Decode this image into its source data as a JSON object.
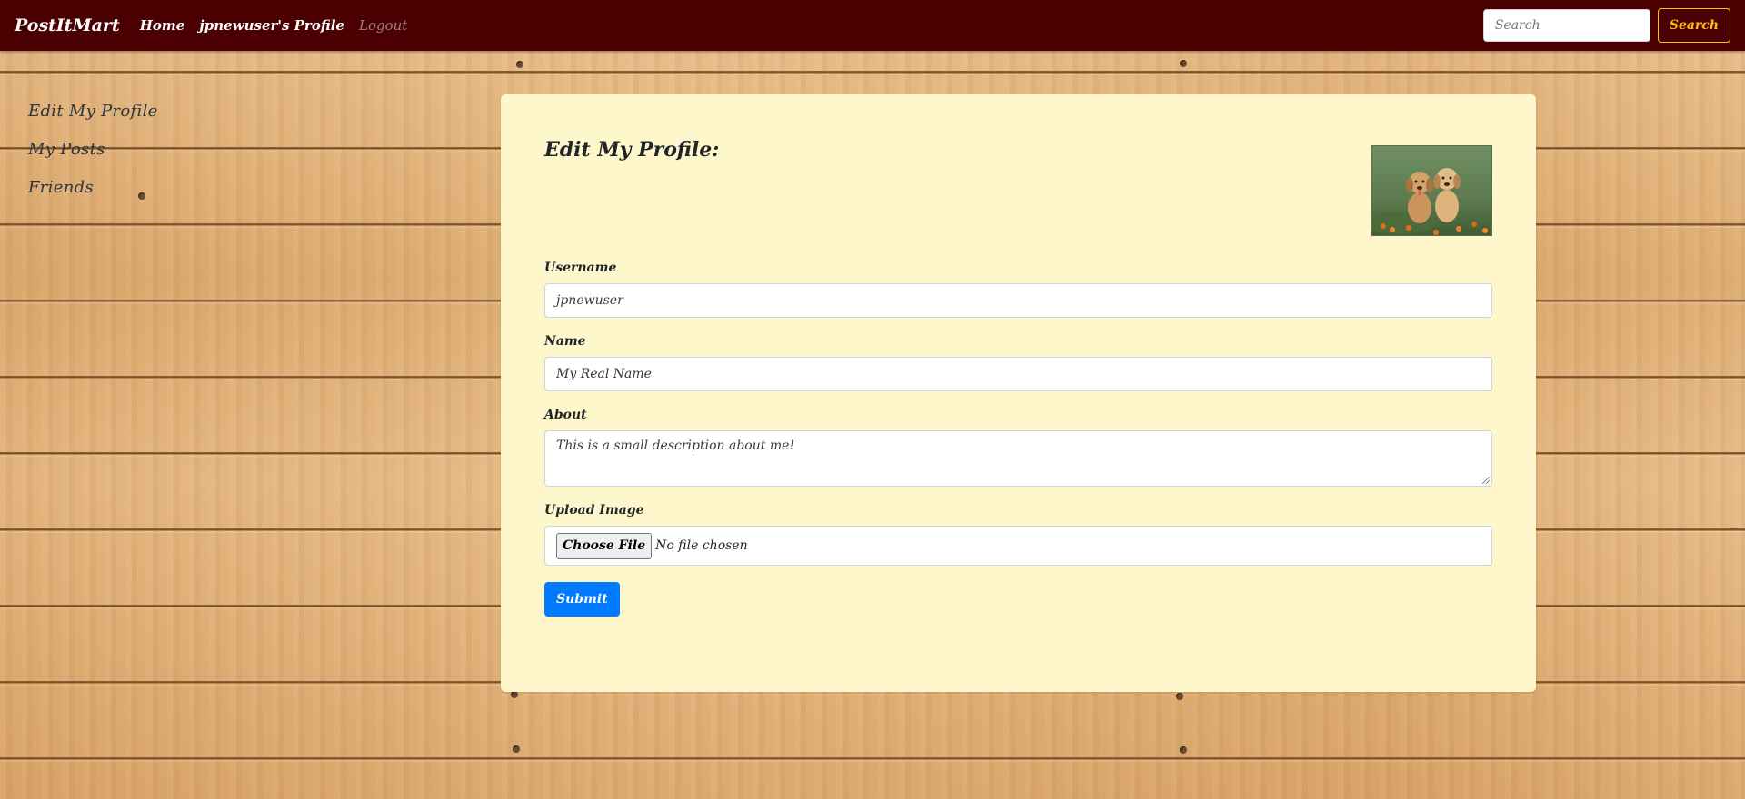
{
  "navbar": {
    "brand": "PostItMart",
    "links": [
      {
        "label": "Home"
      },
      {
        "label": "jpnewuser's Profile"
      },
      {
        "label": "Logout"
      }
    ],
    "search": {
      "placeholder": "Search",
      "button_label": "Search"
    }
  },
  "sidebar": {
    "items": [
      {
        "label": "Edit My Profile"
      },
      {
        "label": "My Posts"
      },
      {
        "label": "Friends"
      }
    ]
  },
  "form": {
    "title": "Edit My Profile:",
    "avatar_icon": "profile-photo-two-puppies",
    "username": {
      "label": "Username",
      "value": "jpnewuser"
    },
    "name": {
      "label": "Name",
      "value": "My Real Name"
    },
    "about": {
      "label": "About",
      "value": "This is a small description about me!"
    },
    "upload": {
      "label": "Upload Image",
      "button_label": "Choose File",
      "status": "No file chosen"
    },
    "submit_label": "Submit"
  },
  "colors": {
    "navbar_bg": "#4a0000",
    "card_bg": "#fff7cc",
    "search_accent": "#ffc107",
    "submit_bg": "#007bff"
  }
}
